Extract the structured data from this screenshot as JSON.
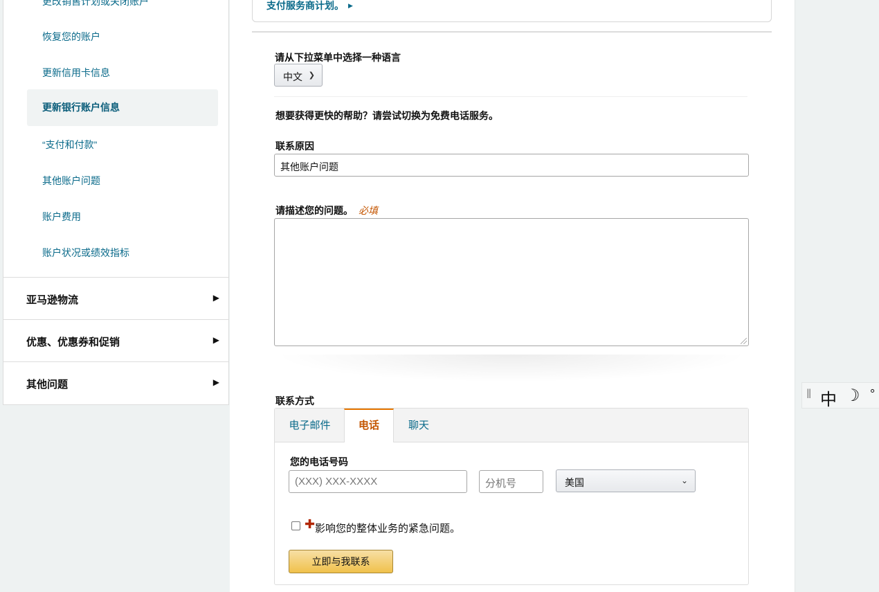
{
  "sidebar": {
    "cut_item": "更改销售计划或关闭账户",
    "items": [
      {
        "label": "恢复您的账户",
        "active": false
      },
      {
        "label": "更新信用卡信息",
        "active": false
      },
      {
        "label": "更新银行账户信息",
        "active": true
      },
      {
        "label": "“支付和付款”",
        "active": false
      },
      {
        "label": "其他账户问题",
        "active": false
      },
      {
        "label": "账户费用",
        "active": false
      },
      {
        "label": "账户状况或绩效指标",
        "active": false
      }
    ],
    "sections": [
      {
        "label": "亚马逊物流"
      },
      {
        "label": "优惠、优惠券和促销"
      },
      {
        "label": "其他问题"
      }
    ]
  },
  "top_box": {
    "link_text": "支付服务商计划。"
  },
  "language": {
    "label": "请从下拉菜单中选择一种语言",
    "selected": "中文"
  },
  "help_text": "想要获得更快的帮助？请尝试切换为免费电话服务。",
  "reason": {
    "label": "联系原因",
    "value": "其他账户问题"
  },
  "description": {
    "label": "请描述您的问题。",
    "required": "必填",
    "value": ""
  },
  "contact": {
    "label": "联系方式",
    "tabs": [
      {
        "label": "电子邮件",
        "active": false
      },
      {
        "label": "电话",
        "active": true
      },
      {
        "label": "聊天",
        "active": false
      }
    ],
    "phone_label": "您的电话号码",
    "phone_placeholder": "(XXX) XXX-XXXX",
    "ext_placeholder": "分机号",
    "country": "美国",
    "urgent_text": "影响您的整体业务的紧急问题。",
    "call_button": "立即与我联系"
  },
  "ime_toolbar": {
    "mode": "中"
  }
}
